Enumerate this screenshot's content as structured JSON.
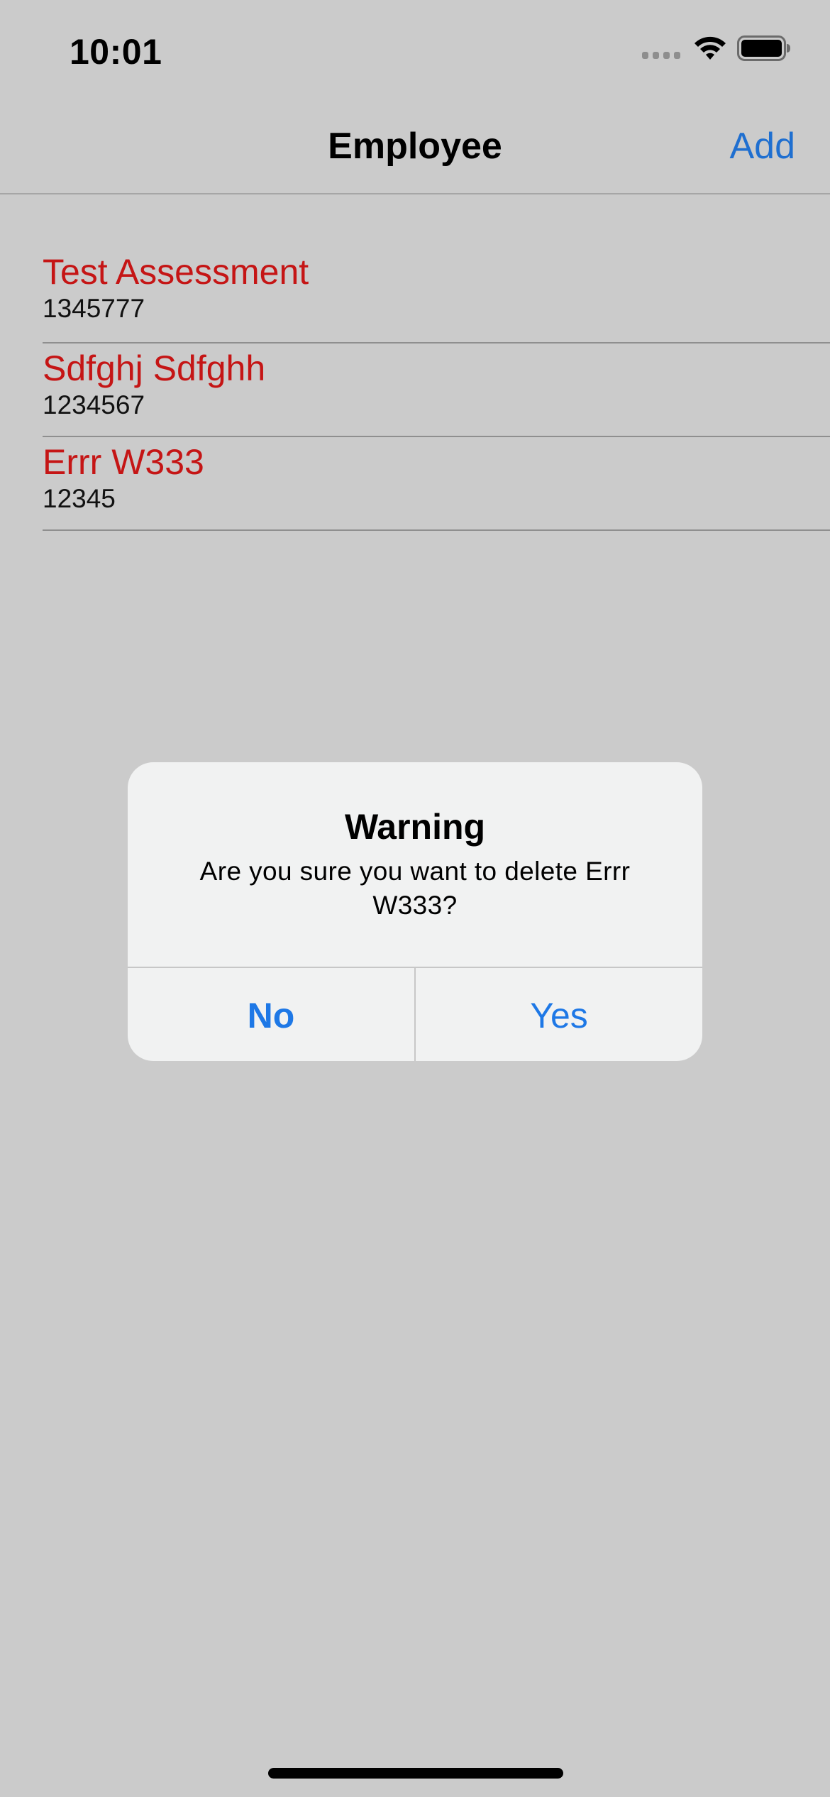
{
  "status_bar": {
    "time": "10:01"
  },
  "nav": {
    "title": "Employee",
    "add_label": "Add"
  },
  "employees": [
    {
      "name": "Test Assessment",
      "number": "1345777"
    },
    {
      "name": "Sdfghj Sdfghh",
      "number": "1234567"
    },
    {
      "name": "Errr W333",
      "number": "12345"
    }
  ],
  "alert": {
    "title": "Warning",
    "message": "Are you sure you want to delete Errr W333?",
    "no_label": "No",
    "yes_label": "Yes"
  },
  "colors": {
    "background": "#cbcbcb",
    "accent": "#1f6fd0",
    "name_text": "#c51515",
    "alert_background": "#f1f2f2"
  }
}
